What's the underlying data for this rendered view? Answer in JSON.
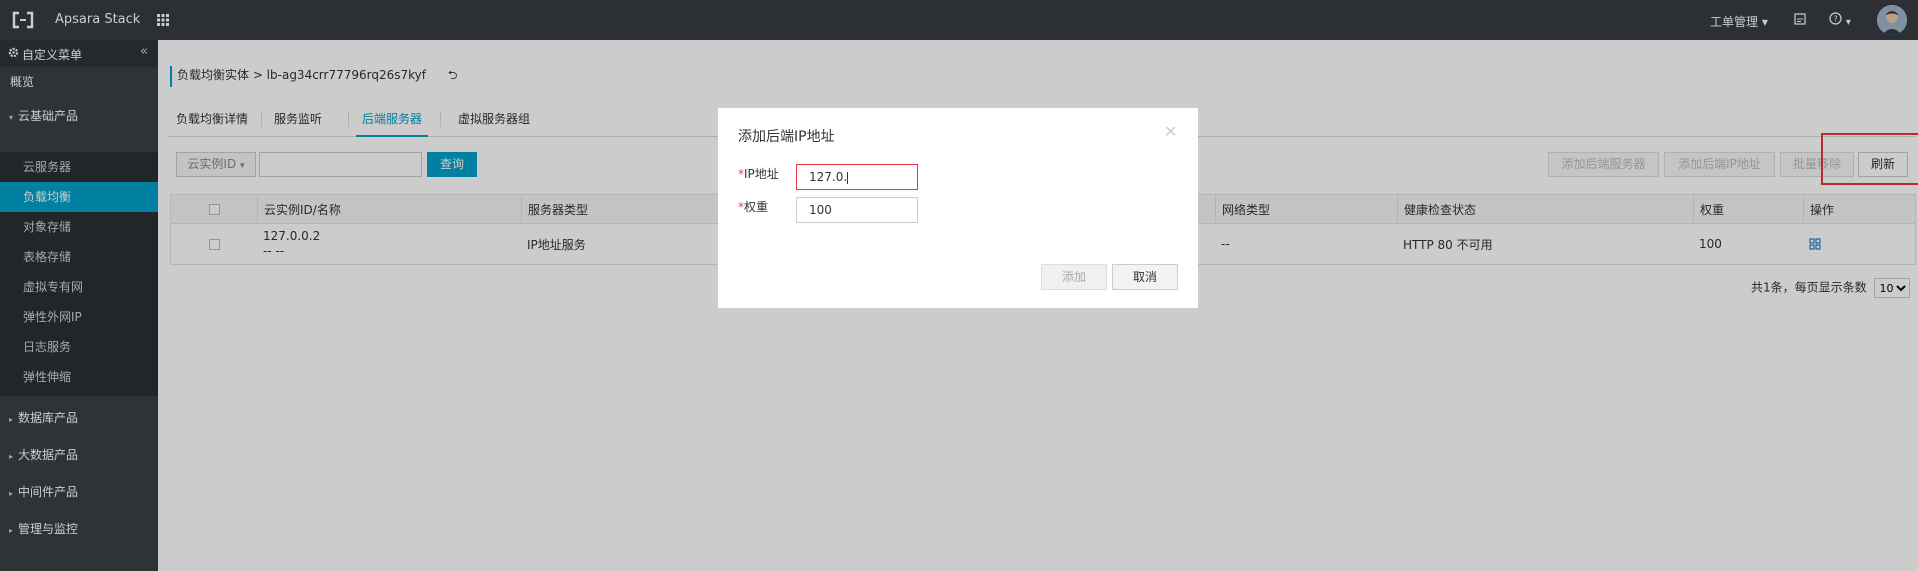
{
  "topbar": {
    "brand": "Apsara Stack",
    "ticket_label": "工单管理",
    "icons": [
      "logo-icon",
      "grid-menu-icon",
      "edit-icon",
      "help-icon",
      "user-avatar"
    ]
  },
  "sidebar": {
    "custom_menu": "自定义菜单",
    "overview": "概览",
    "cloud_basic": "云基础产品",
    "items": [
      "云服务器",
      "负载均衡",
      "对象存储",
      "表格存储",
      "虚拟专有网",
      "弹性外网IP",
      "日志服务",
      "弹性伸缩"
    ],
    "active": "负载均衡",
    "groups": [
      "数据库产品",
      "大数据产品",
      "中间件产品",
      "管理与监控"
    ]
  },
  "breadcrumb": {
    "text": "负载均衡实体 > lb-ag34crr77796rq26s7kyf"
  },
  "tabs": [
    "负载均衡详情",
    "服务监听",
    "后端服务器",
    "虚拟服务器组"
  ],
  "active_tab": "后端服务器",
  "toolbar": {
    "filter_label": "云实例ID",
    "query_label": "查询",
    "add_server": "添加后端服务器",
    "add_ip": "添加后端IP地址",
    "batch_remove": "批量移除",
    "refresh": "刷新"
  },
  "table": {
    "headers": [
      "云实例ID/名称",
      "服务器类型",
      "网络类型",
      "健康检查状态",
      "权重",
      "操作"
    ],
    "rows": [
      {
        "id": "127.0.0.2",
        "name": "-- --",
        "server_type": "IP地址服务",
        "network_type": "--",
        "health": "HTTP 80 不可用",
        "weight": "100"
      }
    ]
  },
  "pager": {
    "summary": "共1条，每页显示条数",
    "page_size": "10"
  },
  "modal": {
    "title": "添加后端IP地址",
    "ip_label": "IP地址",
    "ip_value": "127.0.",
    "weight_label": "权重",
    "weight_value": "100",
    "add_label": "添加",
    "cancel_label": "取消",
    "required_mark": "*"
  },
  "colors": {
    "topbar": "#373d41",
    "sidebar": "#3a4046",
    "accent": "#00a2ca",
    "highlight": "#e4393c"
  }
}
